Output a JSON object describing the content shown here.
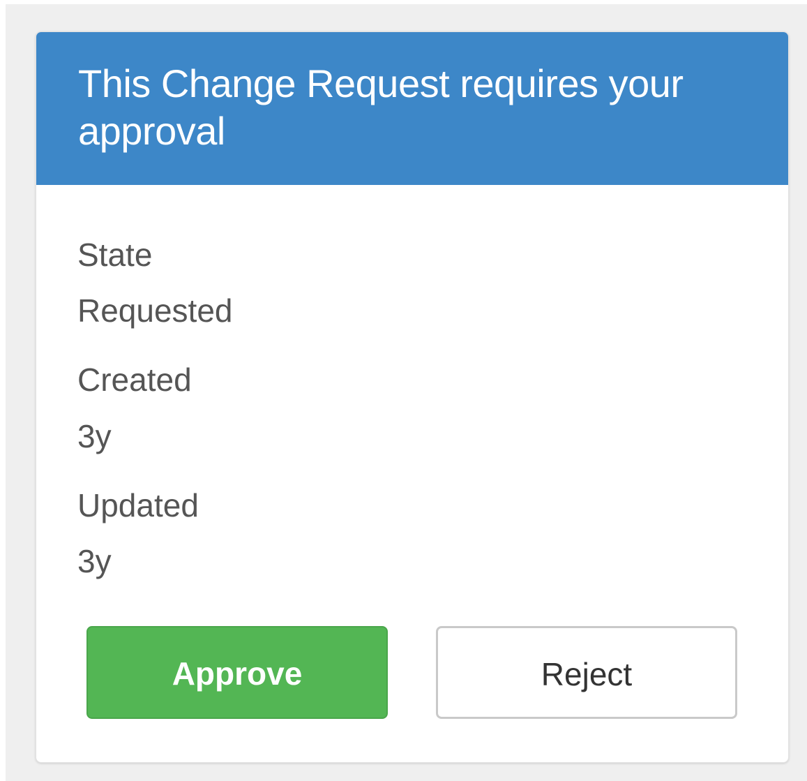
{
  "header": {
    "title": "This Change Request requires your approval",
    "background_color": "#3d87c8"
  },
  "fields": {
    "state_label": "State",
    "state_value": "Requested",
    "created_label": "Created",
    "created_value": "3y",
    "updated_label": "Updated",
    "updated_value": "3y"
  },
  "actions": {
    "approve_label": "Approve",
    "approve_color": "#53b654",
    "reject_label": "Reject"
  }
}
